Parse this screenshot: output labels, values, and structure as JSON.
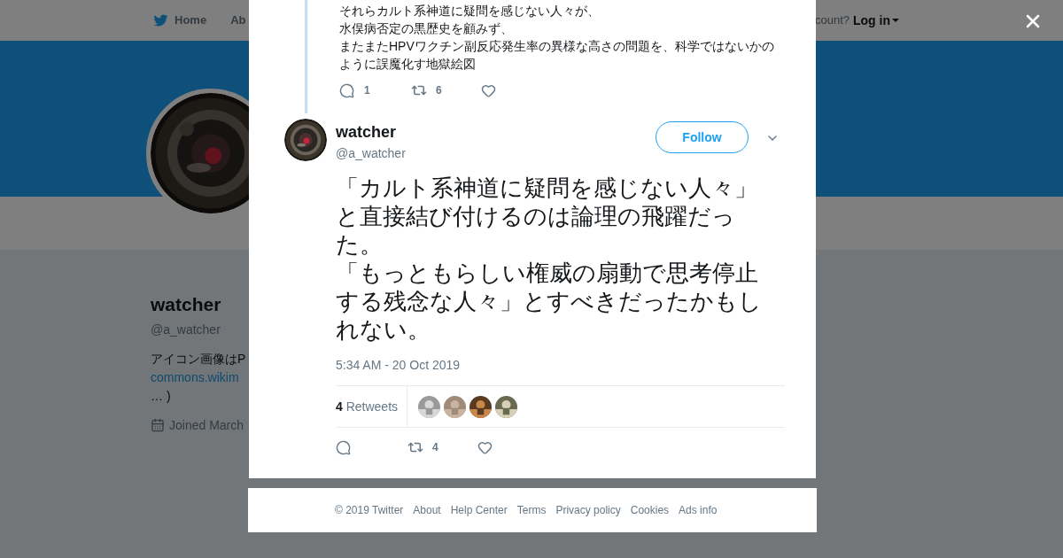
{
  "nav": {
    "items": [
      {
        "label": "Home"
      },
      {
        "label": "Ab"
      }
    ],
    "account_prompt": "count?",
    "login": "Log in"
  },
  "profile": {
    "name": "watcher",
    "handle": "@a_watcher",
    "bio": "アイコン画像はP",
    "link": "commons.wikim",
    "bio_end": "… )",
    "joined": "Joined March"
  },
  "previous_tweet": {
    "lines": [
      "それらカルト系神道に疑問を感じない人々が、",
      "水俣病否定の黒歴史を顧みず、",
      "またまたHPVワクチン副反応発生率の異様な高さの問題を、科学ではないかの",
      "ように誤魔化す地獄絵図"
    ],
    "replies": "1",
    "retweets": "6"
  },
  "tweet": {
    "name": "watcher",
    "handle": "@a_watcher",
    "follow": "Follow",
    "paragraphs": [
      "「カルト系神道に疑問を感じない人々」と直接結び付けるのは論理の飛躍だった。",
      "「もっともらしい権威の扇動で思考停止する残念な人々」とすべきだったかもしれない。"
    ],
    "timestamp": "5:34 AM - 20 Oct 2019",
    "retweet_count": "4",
    "retweet_label": "Retweets",
    "retweets": "4"
  },
  "footer": [
    "© 2019 Twitter",
    "About",
    "Help Center",
    "Terms",
    "Privacy policy",
    "Cookies",
    "Ads info"
  ]
}
